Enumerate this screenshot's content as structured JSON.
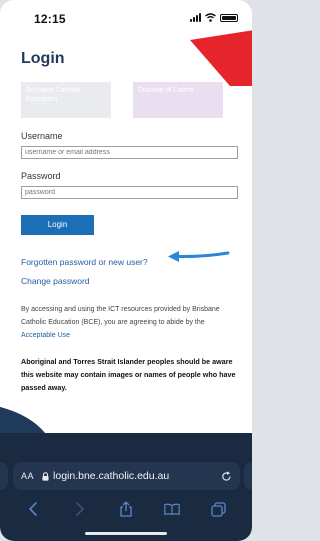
{
  "status_bar": {
    "time": "12:15",
    "signal_icon": "signal-icon",
    "wifi_icon": "wifi-icon",
    "battery_icon": "battery-icon"
  },
  "page": {
    "title": "Login",
    "tiles": [
      "Brisbane Catholic Education",
      "Diocese of Cairns"
    ],
    "username": {
      "label": "Username",
      "placeholder": "username or email address"
    },
    "password": {
      "label": "Password",
      "placeholder": "password"
    },
    "login_button": "Login",
    "forgot_link": "Forgotten password or new user?",
    "change_link": "Change password",
    "terms_text": "By accessing and using the ICT resources provided by Brisbane Catholic Education (BCE), you are agreeing to abide by the ",
    "terms_link": "Acceptable Use",
    "notice": "Aboriginal and Torres Strait Islander peoples should be aware this website may contain images or names of people who have passed away."
  },
  "browser": {
    "text_size_label": "AA",
    "url": "login.bne.catholic.edu.au",
    "icons": [
      "back-icon",
      "forward-icon",
      "share-icon",
      "bookmarks-icon",
      "tabs-icon"
    ]
  },
  "colors": {
    "brand_navy": "#1f3a5a",
    "accent_blue": "#1b6fb6",
    "link_blue": "#1f5e9e",
    "accent_red": "#e5242b",
    "toolbar_dark": "#1a2a40"
  }
}
